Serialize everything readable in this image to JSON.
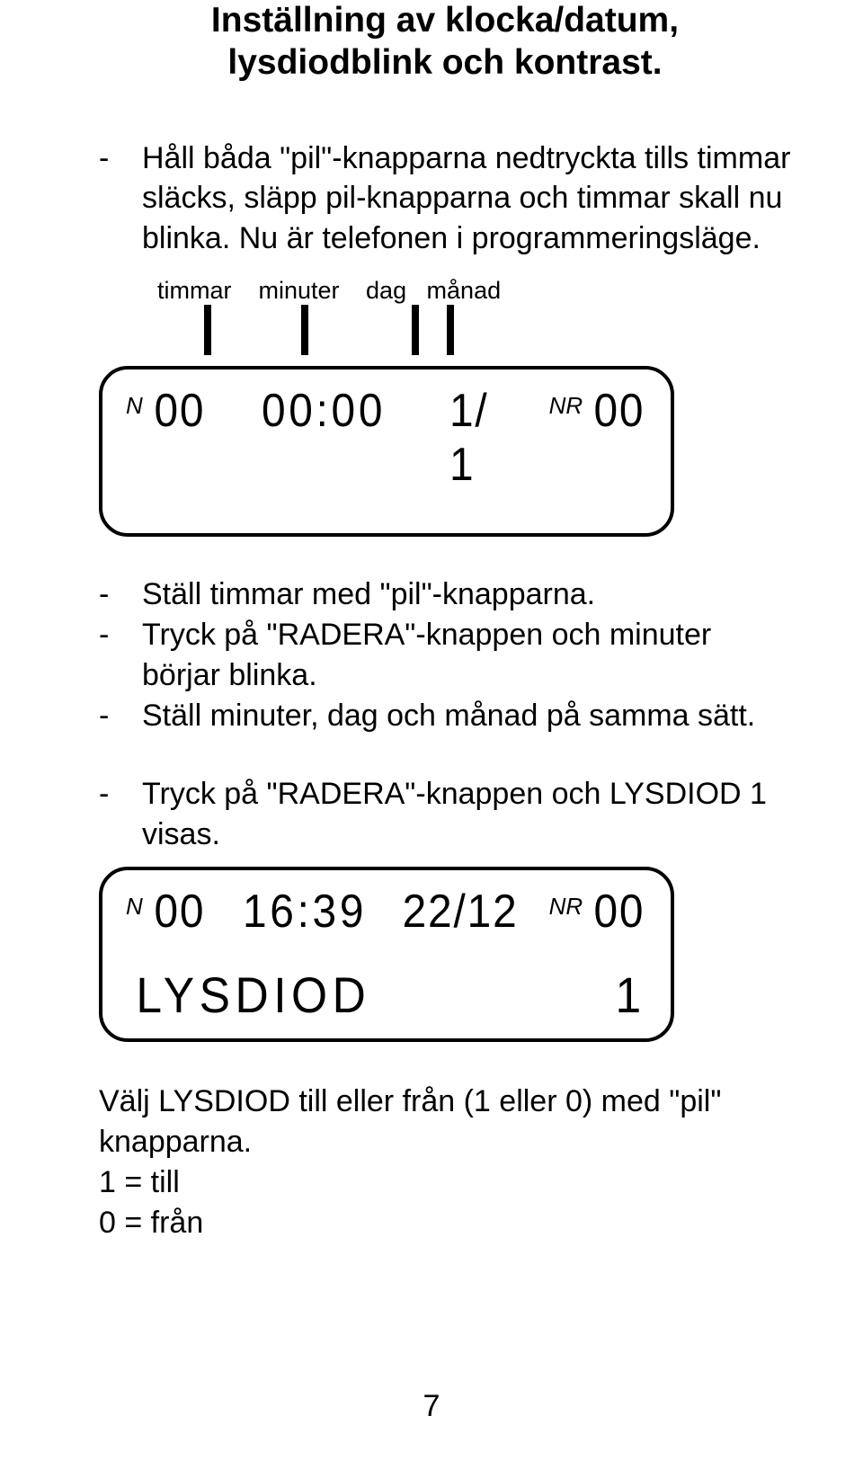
{
  "title": {
    "line1": "Inställning av klocka/datum,",
    "line2": "lysdiodblink och kontrast."
  },
  "para1": {
    "dash": "-",
    "text": "Håll båda \"pil\"-knapparna nedtryckta tills timmar släcks, släpp pil-knapparna och timmar skall nu blinka. Nu är telefonen i programmeringsläge."
  },
  "labels": {
    "timmar": "timmar",
    "minuter": "minuter",
    "dag": "dag",
    "manad": "månad"
  },
  "lcd1": {
    "n_prefix": "N",
    "n_value": "00",
    "time": "00:00",
    "date": "1/ 1",
    "nr_prefix": "NR",
    "nr_value": "00"
  },
  "list2": {
    "dash": "-",
    "item1": "Ställ timmar med \"pil\"-knapparna.",
    "item2": "Tryck på \"RADERA\"-knappen och minuter börjar blinka.",
    "item3": "Ställ minuter, dag och månad på samma sätt."
  },
  "para3": {
    "dash": "-",
    "text": "Tryck på \"RADERA\"-knappen och LYSDIOD  1 visas."
  },
  "lcd2": {
    "n_prefix": "N",
    "n_value": "00",
    "time": "16:39",
    "date": "22/12",
    "nr_prefix": "NR",
    "nr_value": "00",
    "bottom_label": "LYSDIOD",
    "bottom_value": "1"
  },
  "footer": {
    "line1": "Välj LYSDIOD till eller från (1 eller 0) med \"pil\" knapparna.",
    "line2": "1 = till",
    "line3": "0 = från"
  },
  "page_number": "7"
}
